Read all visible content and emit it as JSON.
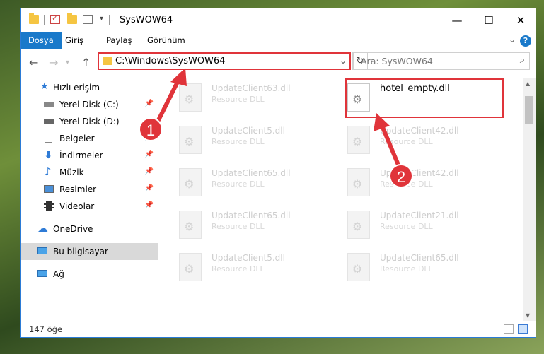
{
  "window": {
    "title": "SysWOW64"
  },
  "ribbon": {
    "tabs": [
      "Dosya",
      "Giriş",
      "Paylaş",
      "Görünüm"
    ]
  },
  "address": {
    "path": "C:\\Windows\\SysWOW64"
  },
  "search": {
    "placeholder": "Ara: SysWOW64"
  },
  "sidebar": {
    "items": [
      {
        "label": "Hızlı erişim",
        "icon": "star-icon"
      },
      {
        "label": "Yerel Disk (C:)",
        "icon": "drive-icon",
        "pinned": true
      },
      {
        "label": "Yerel Disk (D:)",
        "icon": "drive-icon"
      },
      {
        "label": "Belgeler",
        "icon": "document-icon",
        "pinned": true
      },
      {
        "label": "İndirmeler",
        "icon": "download-icon",
        "pinned": true
      },
      {
        "label": "Müzik",
        "icon": "music-icon",
        "pinned": true
      },
      {
        "label": "Resimler",
        "icon": "picture-icon",
        "pinned": true
      },
      {
        "label": "Videolar",
        "icon": "video-icon",
        "pinned": true
      },
      {
        "label": "OneDrive",
        "icon": "cloud-icon"
      },
      {
        "label": "Bu bilgisayar",
        "icon": "computer-icon",
        "selected": true
      },
      {
        "label": "Ağ",
        "icon": "network-icon"
      }
    ]
  },
  "files": {
    "left": [
      {
        "name": "UpdateClient63.dll",
        "type": "Resource DLL"
      },
      {
        "name": "UpdateClient5.dll",
        "type": "Resource DLL"
      },
      {
        "name": "UpdateClient65.dll",
        "type": "Resource DLL"
      },
      {
        "name": "UpdateClient65.dll",
        "type": "Resource DLL"
      },
      {
        "name": "UpdateClient5.dll",
        "type": "Resource DLL"
      }
    ],
    "right": [
      {
        "name": "hotel_empty.dll",
        "type": ""
      },
      {
        "name": "UpdateClient42.dll",
        "type": "Resource DLL"
      },
      {
        "name": "UpdateClient42.dll",
        "type": "Resource DLL"
      },
      {
        "name": "UpdateClient21.dll",
        "type": "Resource DLL"
      },
      {
        "name": "UpdateClient65.dll",
        "type": "Resource DLL"
      }
    ]
  },
  "status": {
    "count_text": "147 öğe"
  },
  "annotations": {
    "callout1": "1",
    "callout2": "2"
  },
  "colors": {
    "accent": "#1979ca",
    "annotation": "#e0343a"
  }
}
